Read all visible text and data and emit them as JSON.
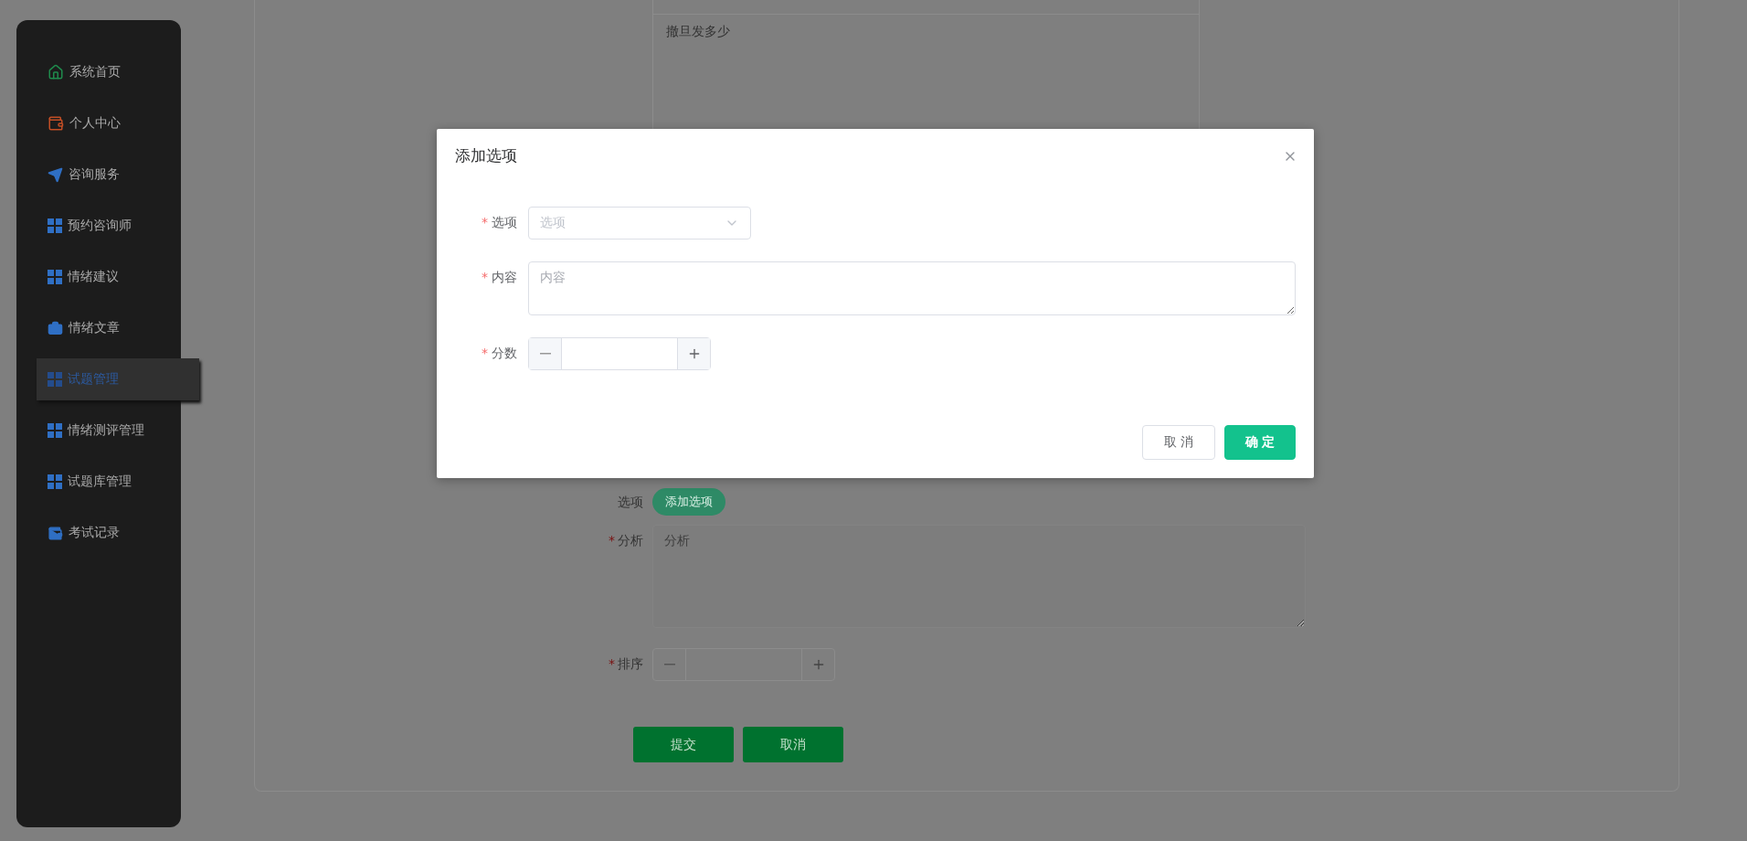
{
  "sidebar": {
    "items": [
      {
        "label": "系统首页",
        "kind": "home",
        "selected": false
      },
      {
        "label": "个人中心",
        "kind": "wallet",
        "selected": false
      },
      {
        "label": "咨询服务",
        "kind": "send",
        "selected": false
      },
      {
        "label": "预约咨询师",
        "kind": "grid",
        "selected": false
      },
      {
        "label": "情绪建议",
        "kind": "grid",
        "selected": false
      },
      {
        "label": "情绪文章",
        "kind": "briefcase",
        "selected": false
      },
      {
        "label": "试题管理",
        "kind": "grid",
        "selected": true
      },
      {
        "label": "情绪测评管理",
        "kind": "grid",
        "selected": false
      },
      {
        "label": "试题库管理",
        "kind": "grid",
        "selected": false
      },
      {
        "label": "考试记录",
        "kind": "purse",
        "selected": false
      }
    ]
  },
  "form": {
    "content_text": "撤旦发多少",
    "options_label": "选项",
    "add_option_button": "添加选项",
    "analysis": {
      "label": "分析",
      "placeholder": "分析",
      "required_mark": "*"
    },
    "order": {
      "label": "排序",
      "required_mark": "*"
    },
    "buttons": [
      "提交",
      "取消"
    ]
  },
  "modal": {
    "title": "添加选项",
    "fields": [
      {
        "kind": "select",
        "label": "选项",
        "placeholder": "选项",
        "required_mark": "*"
      },
      {
        "kind": "textarea",
        "label": "内容",
        "placeholder": "内容",
        "required_mark": "*"
      },
      {
        "kind": "number",
        "label": "分数",
        "required_mark": "*"
      }
    ],
    "buttons": [
      {
        "label": "取 消",
        "kind": "default"
      },
      {
        "label": "确 定",
        "kind": "primary"
      }
    ]
  }
}
